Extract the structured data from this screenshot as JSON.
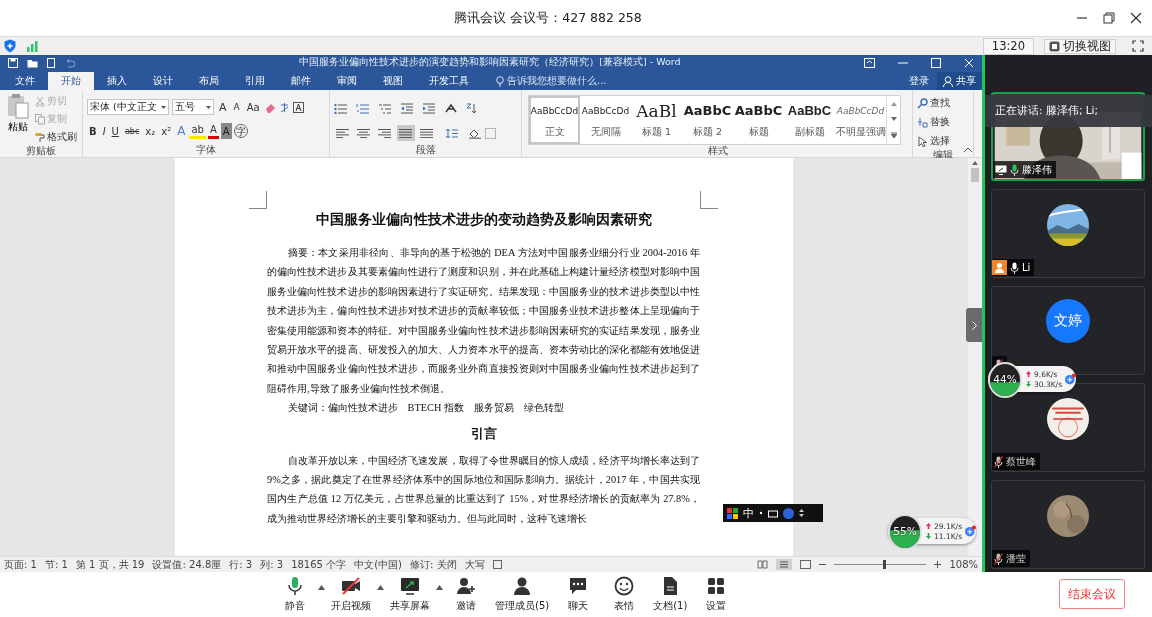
{
  "meeting_title": "腾讯会议 会议号：427 882 258",
  "top_bar": {
    "time": "13:20",
    "switch_view": "切换视图"
  },
  "word": {
    "title": "中国服务业偏向性技术进步的演变趋势和影响因素研究（经济研究）[兼容模式] - Word",
    "tabs": [
      {
        "label": "文件",
        "selected": false
      },
      {
        "label": "开始",
        "selected": true
      },
      {
        "label": "插入",
        "selected": false
      },
      {
        "label": "设计",
        "selected": false
      },
      {
        "label": "布局",
        "selected": false
      },
      {
        "label": "引用",
        "selected": false
      },
      {
        "label": "邮件",
        "selected": false
      },
      {
        "label": "审阅",
        "selected": false
      },
      {
        "label": "视图",
        "selected": false
      },
      {
        "label": "开发工具",
        "selected": false
      }
    ],
    "tell_me": "告诉我您想要做什么...",
    "sign_in": "登录",
    "share": "共享",
    "clipboard": {
      "paste": "粘贴",
      "group": "剪贴板",
      "tools": [
        {
          "label": "剪切",
          "kind": "cut",
          "disabled": true
        },
        {
          "label": "复制",
          "kind": "copy",
          "disabled": true
        },
        {
          "label": "格式刷",
          "kind": "painter",
          "disabled": false
        }
      ]
    },
    "font": {
      "name": "宋体 (中文正文",
      "size": "五号",
      "group": "字体",
      "row1": [
        {
          "text": "A",
          "kind": "grow"
        },
        {
          "text": "A",
          "kind": "shrink"
        },
        {
          "text": "Aa",
          "kind": "case"
        }
      ],
      "row2": [
        {
          "text": "B",
          "kind": "bold"
        },
        {
          "text": "I",
          "kind": "italic"
        },
        {
          "text": "U",
          "kind": "underline"
        },
        {
          "text": "abc",
          "kind": "strike"
        },
        {
          "text": "x₂",
          "kind": "sub"
        },
        {
          "text": "x²",
          "kind": "super"
        },
        {
          "text": "A",
          "kind": "effects"
        },
        {
          "text": "ab",
          "kind": "highlight"
        },
        {
          "text": "A",
          "kind": "color"
        },
        {
          "text": "A",
          "kind": "shading"
        },
        {
          "text": "字",
          "kind": "enclose"
        }
      ]
    },
    "paragraph": {
      "group": "段落",
      "alignments": [
        {
          "kind": "left",
          "selected": false
        },
        {
          "kind": "center",
          "selected": false
        },
        {
          "kind": "right",
          "selected": false
        },
        {
          "kind": "justify",
          "selected": true
        },
        {
          "kind": "distributed",
          "selected": false
        }
      ]
    },
    "styles": {
      "group": "样式",
      "items": [
        {
          "preview": "AaBbCcDd",
          "label": "正文",
          "kind": "body",
          "selected": true
        },
        {
          "preview": "AaBbCcDd",
          "label": "无间隔",
          "kind": "body",
          "selected": false
        },
        {
          "preview": "AaBl",
          "label": "标题 1",
          "kind": "heading1",
          "selected": false
        },
        {
          "preview": "AaBbC",
          "label": "标题 2",
          "kind": "heading2",
          "selected": false
        },
        {
          "preview": "AaBbC",
          "label": "标题",
          "kind": "title",
          "selected": false
        },
        {
          "preview": "AaBbC",
          "label": "副标题",
          "kind": "subtitle",
          "selected": false
        },
        {
          "preview": "AaBbCcDd",
          "label": "不明显强调",
          "kind": "emphasis",
          "selected": false
        }
      ]
    },
    "editing": {
      "group": "编辑",
      "tools": [
        {
          "label": "查找",
          "kind": "find"
        },
        {
          "label": "替换",
          "kind": "replace"
        },
        {
          "label": "选择",
          "kind": "select"
        }
      ]
    },
    "document": {
      "title": "中国服务业偏向性技术进步的变动趋势及影响因素研究",
      "abstract": "摘要：本文采用非径向、非导向的基于松弛的 DEA 方法对中国服务业细分行业 2004-2016 年的偏向性技术进步及其要素偏向性进行了测度和识别，并在此基础上构建计量经济模型对影响中国服务业偏向性技术进步的影响因素进行了实证研究。结果发现：中国服务业的技术进步类型以中性技术进步为主，偏向性技术进步对技术进步的贡献率较低；中国服务业技术进步整体上呈现偏向于密集使用能源和资本的特征。对中国服务业偏向性技术进步影响因素研究的实证结果发现，服务业贸易开放水平的提高、研发投入的加大、人力资本水平的提高、资本劳动比的深化都能有效地促进和推动中国服务业偏向性技术进步，而服务业外商直接投资则对中国服务业偏向性技术进步起到了阻碍作用,导致了服务业偏向性技术倒退。",
      "keywords": "关键词：偏向性技术进步　BTECH 指数　服务贸易　绿色转型",
      "heading": "引言",
      "intro": "自改革开放以来，中国经济飞速发展，取得了令世界瞩目的惊人成绩，经济平均增长率达到了 9%之多，据此奠定了在世界经济体系中的国际地位和国际影响力。据统计，2017 年，中国共实现国内生产总值 12 万亿美元，占世界总量的比重达到了 15%，对世界经济增长的贡献率为 27.8%，成为推动世界经济增长的主要引擎和驱动力。但与此同时，这种飞速增长"
    },
    "status_bar": [
      "页面: 1",
      "节: 1",
      "第 1 页，共 19",
      "设置值: 24.8厘",
      "行: 3",
      "列: 3",
      "18165 个字",
      "中文(中国)",
      "修订: 关闭",
      "大写"
    ],
    "zoom": {
      "level": 0.53,
      "text": "108%"
    }
  },
  "ime_bar": {
    "label": "中"
  },
  "net_widgets": [
    {
      "text": "55%",
      "level": 0.55,
      "up": "29.1K/s",
      "down": "11.1K/s"
    },
    {
      "text": "44%",
      "level": 0.44,
      "up": "9.6K/s",
      "down": "30.3K/s"
    }
  ],
  "speaking": "正在讲话: 滕泽伟; Li;",
  "participants": [
    {
      "name": "滕泽伟",
      "kind": "video",
      "muted": false,
      "sharing": true,
      "host": false,
      "speaking": true
    },
    {
      "name": "Li",
      "muted": false,
      "sharing": false,
      "host": true,
      "speaking": false
    },
    {
      "kind": "initials",
      "avatar_text": "文婷",
      "muted": true,
      "sharing": false,
      "host": false,
      "speaking": false
    },
    {
      "name": "蔡世峰",
      "muted": true,
      "sharing": false,
      "host": false,
      "speaking": false
    },
    {
      "name": "潘莹",
      "muted": true,
      "sharing": false,
      "host": false,
      "speaking": false
    }
  ],
  "toolbar": [
    {
      "label": "静音",
      "kind": "mic",
      "menu": true
    },
    {
      "label": "开启视频",
      "kind": "video",
      "menu": true,
      "on": false
    },
    {
      "label": "共享屏幕",
      "kind": "share",
      "menu": true
    },
    {
      "label": "邀请",
      "kind": "invite",
      "menu": false
    },
    {
      "label": "管理成员(5)",
      "kind": "members",
      "menu": false
    },
    {
      "label": "聊天",
      "kind": "chat",
      "menu": false
    },
    {
      "label": "表情",
      "kind": "emoji",
      "menu": false
    },
    {
      "label": "文档(1)",
      "kind": "docs",
      "menu": false
    },
    {
      "label": "设置",
      "kind": "settings",
      "menu": false
    }
  ],
  "end_meeting": "结束会议"
}
